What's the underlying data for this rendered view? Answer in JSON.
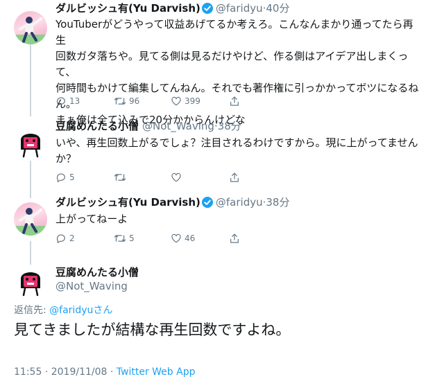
{
  "tweets": [
    {
      "name": "ダルビッシュ有(Yu Darvish)",
      "verified": true,
      "handle": "@faridyu",
      "time": "40分",
      "lines": [
        "YouTuberがどうやって収益あげてるか考えろ。こんなんまかり通ってたら再生",
        "回数ガタ落ちや。見てる側は見るだけやけど、作る側はアイデア出しまくって、",
        "何時間もかけて編集してんねん。それでも著作権に引っかかってボツになるね",
        "ん。",
        "まぁ俺は全て込みで20分かからんけどな"
      ],
      "replies": "13",
      "retweets": "96",
      "likes": "399"
    },
    {
      "name": "豆腐めんたる小僧",
      "verified": false,
      "handle": "@Not_Waving",
      "time": "38分",
      "lines": [
        "いや、再生回数上がるでしょ？注目されるわけですから。現に上がってません",
        "か？"
      ],
      "replies": "5",
      "retweets": "",
      "likes": ""
    },
    {
      "name": "ダルビッシュ有(Yu Darvish)",
      "verified": true,
      "handle": "@faridyu",
      "time": "38分",
      "lines": [
        "上がってねーよ"
      ],
      "replies": "2",
      "retweets": "5",
      "likes": "46"
    }
  ],
  "focus": {
    "name": "豆腐めんたる小僧",
    "handle": "@Not_Waving",
    "reply_label": "返信先: ",
    "reply_handle": "@faridyu",
    "reply_suffix": "さん",
    "text": "見てきましたが結構な再生回数ですよね。",
    "time": "11:55",
    "date": "2019/11/08",
    "separator": "·",
    "client": "Twitter Web App"
  },
  "colors": {
    "accent": "#1da1f2",
    "muted": "#657786",
    "text": "#14171a",
    "thread_line": "#ccd6dd",
    "tofu_pink": "#e8336e"
  },
  "icons": [
    "reply-icon",
    "retweet-icon",
    "like-icon",
    "share-icon",
    "verified-badge-icon"
  ]
}
